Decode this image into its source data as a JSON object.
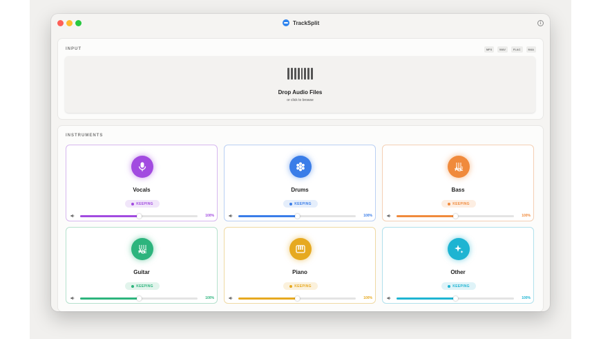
{
  "app": {
    "title": "TrackSplit"
  },
  "input": {
    "section_label": "INPUT",
    "formats": [
      "MP3",
      "WAV",
      "FLAC",
      "M4A"
    ],
    "dropzone": {
      "title": "Drop Audio Files",
      "subtitle": "or click to browse"
    }
  },
  "instruments": {
    "section_label": "INSTRUMENTS",
    "items": [
      {
        "name": "Vocals",
        "status": "KEEPING",
        "volume_label": "100%",
        "slider_fraction": 0.5,
        "icon": "microphone-icon",
        "color": "#a24be0",
        "badge_bg": "#f1e6fa",
        "border": "#d6b6ef"
      },
      {
        "name": "Drums",
        "status": "KEEPING",
        "volume_label": "100%",
        "slider_fraction": 0.5,
        "icon": "drum-icon",
        "color": "#3a7de8",
        "badge_bg": "#e5eefb",
        "border": "#b9cff3"
      },
      {
        "name": "Bass",
        "status": "KEEPING",
        "volume_label": "100%",
        "slider_fraction": 0.5,
        "icon": "bass-guitar-icon",
        "color": "#f08a3c",
        "badge_bg": "#fdeee2",
        "border": "#f4cfb3"
      },
      {
        "name": "Guitar",
        "status": "KEEPING",
        "volume_label": "100%",
        "slider_fraction": 0.5,
        "icon": "guitar-icon",
        "color": "#2db47d",
        "badge_bg": "#e2f4ec",
        "border": "#b5e1cd"
      },
      {
        "name": "Piano",
        "status": "KEEPING",
        "volume_label": "100%",
        "slider_fraction": 0.5,
        "icon": "piano-icon",
        "color": "#e6a920",
        "badge_bg": "#fbf1dc",
        "border": "#efd9a3"
      },
      {
        "name": "Other",
        "status": "KEEPING",
        "volume_label": "100%",
        "slider_fraction": 0.5,
        "icon": "sparkles-icon",
        "color": "#1eb4d2",
        "badge_bg": "#dff3f8",
        "border": "#b0e0ec"
      }
    ]
  }
}
